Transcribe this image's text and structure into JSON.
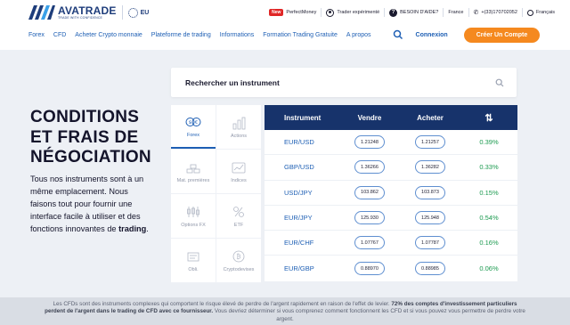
{
  "header": {
    "logo_name": "AVATRADE",
    "logo_tagline": "TRADE WITH CONFIDENCE",
    "eu_label": "EU",
    "new_badge": "New",
    "perfect_money": "PerfectMoney",
    "trader_link": "Trader expérimenté",
    "help_link": "BESOIN D'AIDE?",
    "country": "France",
    "phone": "+(33)170702052",
    "language": "Français"
  },
  "nav": {
    "items": [
      "Forex",
      "CFD",
      "Acheter Crypto monnaie",
      "Plateforme de trading",
      "Informations",
      "Formation Trading Gratuite",
      "A propos"
    ],
    "login": "Connexion",
    "cta": "Créer Un Compte"
  },
  "search": {
    "placeholder": "Rechercher un instrument"
  },
  "hero": {
    "title_line1": "CONDITIONS",
    "title_line2": "ET FRAIS DE",
    "title_line3": "NÉGOCIATION",
    "desc_text": "Tous nos instruments sont à un même emplacement. Nous faisons tout pour fournir une interface facile à utiliser et des fonctions innovantes de ",
    "desc_bold": "trading",
    "desc_end": "."
  },
  "categories": [
    {
      "label": "Forex",
      "icon": "forex-icon",
      "active": true
    },
    {
      "label": "Actions",
      "icon": "stocks-icon",
      "active": false
    },
    {
      "label": "Mat. premières",
      "icon": "commodities-icon",
      "active": false
    },
    {
      "label": "Indices",
      "icon": "indices-icon",
      "active": false
    },
    {
      "label": "Options FX",
      "icon": "fx-options-icon",
      "active": false
    },
    {
      "label": "ETF",
      "icon": "etf-icon",
      "active": false
    },
    {
      "label": "Obli.",
      "icon": "bonds-icon",
      "active": false
    },
    {
      "label": "Cryptodevises",
      "icon": "crypto-icon",
      "active": false
    }
  ],
  "table": {
    "headers": {
      "instrument": "Instrument",
      "sell": "Vendre",
      "buy": "Acheter",
      "sort_icon": "⇅"
    },
    "rows": [
      {
        "instrument": "EUR/USD",
        "sell": "1.21248",
        "buy": "1.21257",
        "change": "0.39%"
      },
      {
        "instrument": "GBP/USD",
        "sell": "1.36266",
        "buy": "1.36282",
        "change": "0.33%"
      },
      {
        "instrument": "USD/JPY",
        "sell": "103.862",
        "buy": "103.873",
        "change": "0.15%"
      },
      {
        "instrument": "EUR/JPY",
        "sell": "125.930",
        "buy": "125.948",
        "change": "0.54%"
      },
      {
        "instrument": "EUR/CHF",
        "sell": "1.07767",
        "buy": "1.07787",
        "change": "0.16%"
      },
      {
        "instrument": "EUR/GBP",
        "sell": "0.88970",
        "buy": "0.88985",
        "change": "0.06%"
      }
    ]
  },
  "disclaimer": {
    "part1": "Les CFDs sont des instruments complexes qui comportent le risque élevé de perdre de l'argent rapidement en raison de l'effet de levier. ",
    "bold": "72% des comptes d'investissement particuliers perdent de l'argent dans le trading de CFD avec ce fournisseur.",
    "part2": " Vous devriez déterminer si vous comprenez comment fonctionnent les CFD et si vous pouvez vous permettre de perdre votre argent."
  },
  "colors": {
    "brand_navy": "#17336b",
    "link_blue": "#1e5fb4",
    "cta_orange": "#f5891f",
    "positive_green": "#1b9a4f",
    "new_red": "#e02626"
  }
}
